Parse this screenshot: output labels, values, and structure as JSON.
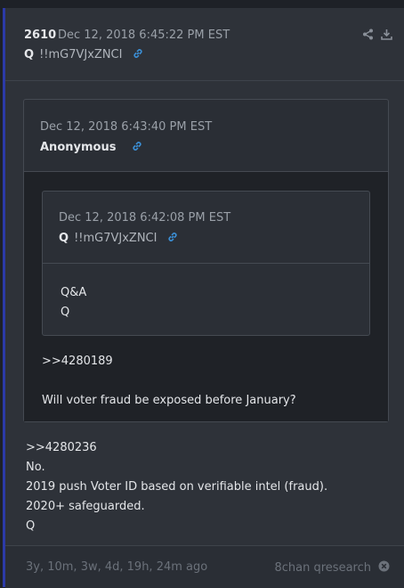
{
  "post": {
    "number": "2610",
    "timestamp": "Dec 12, 2018 6:45:22 PM EST",
    "author": "Q",
    "tripcode": "!!mG7VJxZNCI"
  },
  "quote1": {
    "timestamp": "Dec 12, 2018 6:43:40 PM EST",
    "author": "Anonymous",
    "lines": [
      ">>4280189",
      "",
      "Will voter fraud be exposed before January?"
    ]
  },
  "quote2": {
    "timestamp": "Dec 12, 2018 6:42:08 PM EST",
    "author": "Q",
    "tripcode": "!!mG7VJxZNCI",
    "lines": [
      "Q&A",
      "Q"
    ]
  },
  "body": {
    "lines": [
      ">>4280236",
      "No.",
      "2019 push Voter ID based on verifiable intel (fraud).",
      "2020+ safeguarded.",
      "Q"
    ]
  },
  "footer": {
    "age": "3y, 10m, 3w, 4d, 19h, 24m ago",
    "source": "8chan qresearch"
  },
  "colors": {
    "accent_border": "#2c3aa8",
    "link": "#3b8fd6"
  }
}
